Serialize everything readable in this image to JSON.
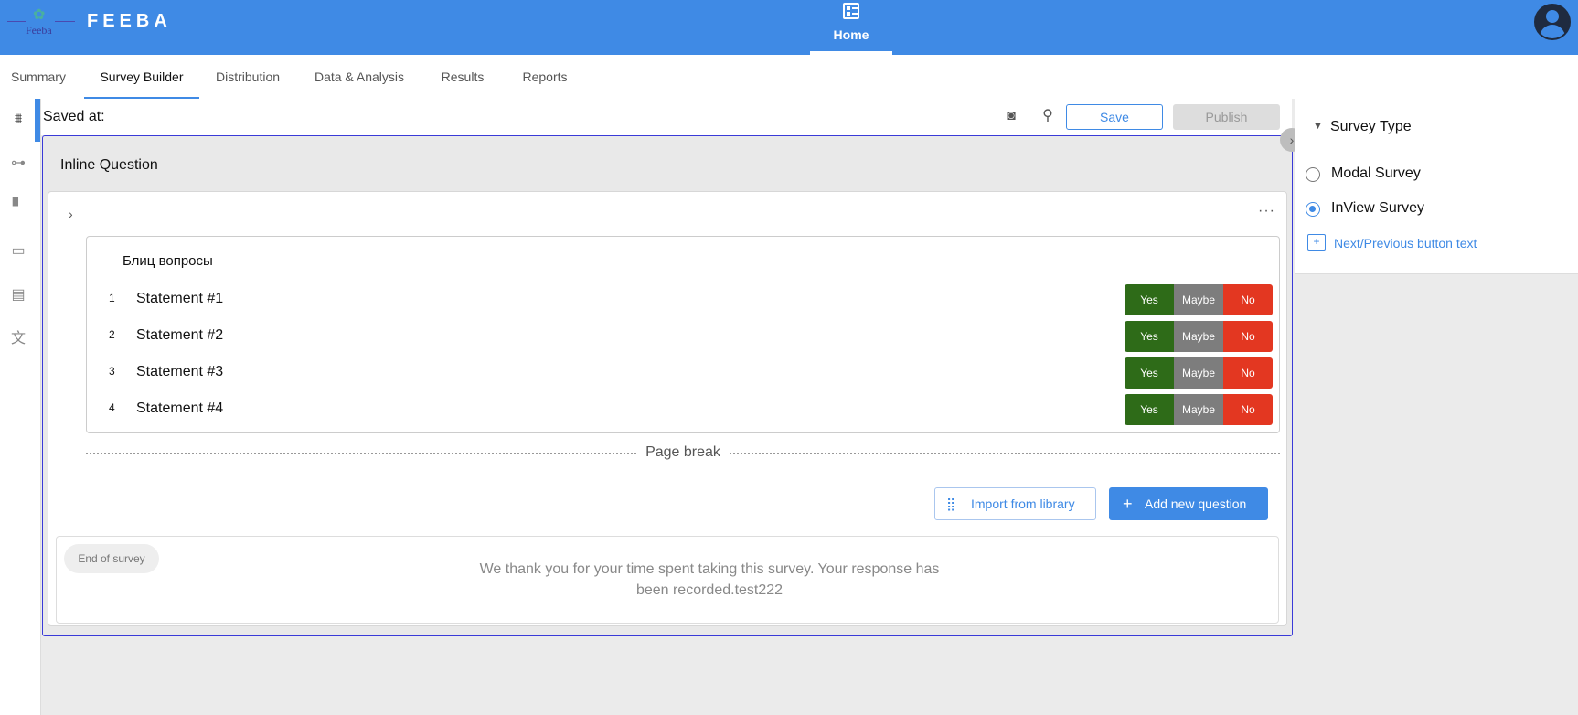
{
  "header": {
    "logo_text": "Feeba",
    "brand": "FEEBA",
    "home_label": "Home",
    "icons": {
      "home": "checklist-icon",
      "avatar": "account-circle-icon"
    }
  },
  "tabs": [
    {
      "label": "Summary",
      "active": false
    },
    {
      "label": "Survey Builder",
      "active": true
    },
    {
      "label": "Distribution",
      "active": false
    },
    {
      "label": "Data & Analysis",
      "active": false
    },
    {
      "label": "Results",
      "active": false
    },
    {
      "label": "Reports",
      "active": false
    }
  ],
  "left_rail": [
    "builder-icon",
    "flow-icon",
    "paint-roller-icon",
    "display-icon",
    "document-icon",
    "translate-icon"
  ],
  "toolbar": {
    "saved_label": "Saved at:",
    "save_label": "Save",
    "publish_label": "Publish",
    "icons": {
      "preview": "preview-icon",
      "search": "search-icon"
    }
  },
  "survey": {
    "inline_title": "Inline Question",
    "matrix_title": "Блиц вопросы",
    "statements": [
      {
        "num": "1",
        "text": "Statement #1"
      },
      {
        "num": "2",
        "text": "Statement #2"
      },
      {
        "num": "3",
        "text": "Statement #3"
      },
      {
        "num": "4",
        "text": "Statement #4"
      }
    ],
    "answers": {
      "yes": "Yes",
      "maybe": "Maybe",
      "no": "No"
    },
    "page_break": "Page break",
    "import_label": "Import from library",
    "add_label": "Add new question",
    "end_badge": "End of survey",
    "end_text": "We thank you for your time spent taking this survey. Your response has been recorded.test222"
  },
  "right_panel": {
    "title": "Survey Type",
    "options": [
      {
        "label": "Modal Survey",
        "checked": false
      },
      {
        "label": "InView Survey",
        "checked": true
      }
    ],
    "link": "Next/Previous button text"
  },
  "colors": {
    "accent": "#3f8ae5",
    "yes": "#2e6b18",
    "maybe": "#7d7d7d",
    "no": "#e33721",
    "frame": "#3a3ad8"
  }
}
